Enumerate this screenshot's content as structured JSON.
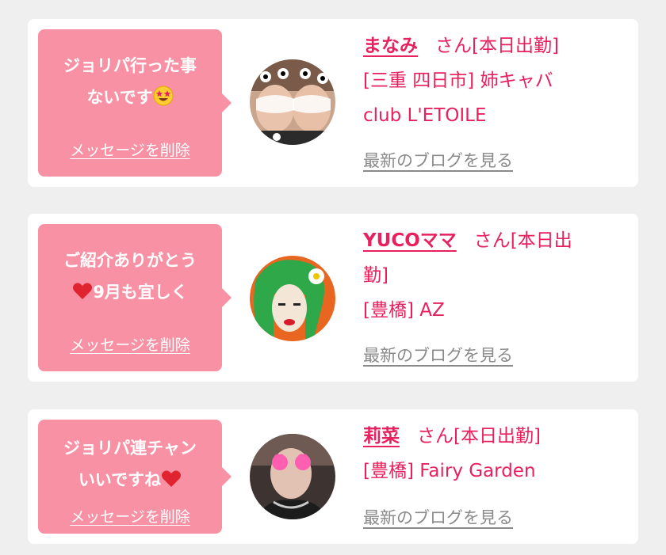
{
  "colors": {
    "page_background": "#efefef",
    "card_background": "#ffffff",
    "bubble": "#f991a5",
    "accent_text": "#e8215e",
    "link_gray": "#8a8a8a"
  },
  "cards": [
    {
      "message_line1": "ジョリパ行った事",
      "message_line2": "ないです",
      "message_emoji": "star-struck-emoji",
      "delete_label": "メッセージを削除",
      "name": "まなみ",
      "suffix": "さん[本日出勤]",
      "area": "[三重 四日市] 姉キャバ",
      "shop": "club L'ETOILE",
      "blog_link": "最新のブログを見る"
    },
    {
      "message_line1": "ご紹介ありがとう",
      "message_line2": "9月も宜しく",
      "message_emoji": "red-heart-emoji",
      "delete_label": "メッセージを削除",
      "name": "YUCOママ",
      "suffix": "さん[本日出",
      "suffix_wrap": "勤]",
      "area": "[豊橋] AZ",
      "blog_link": "最新のブログを見る"
    },
    {
      "message_line1": "ジョリパ連チャン",
      "message_line2": "いいですね",
      "message_emoji": "red-heart-emoji",
      "delete_label": "メッセージを削除",
      "name": "莉菜",
      "suffix": "さん[本日出勤]",
      "area": "[豊橋] Fairy Garden",
      "blog_link": "最新のブログを見る"
    }
  ]
}
